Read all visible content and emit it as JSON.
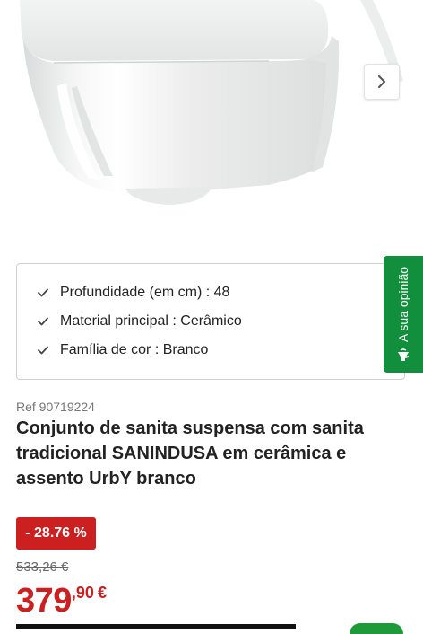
{
  "gallery": {
    "next_icon": "chevron-right-icon"
  },
  "features": [
    {
      "icon": "check-icon",
      "text": "Profundidade (em cm) : 48"
    },
    {
      "icon": "check-icon",
      "text": "Material principal : Cerâmico"
    },
    {
      "icon": "check-icon",
      "text": "Família de cor : Branco"
    }
  ],
  "feedback": {
    "label": "A sua opinião",
    "icon": "megaphone-icon",
    "color": "#128f3c"
  },
  "product": {
    "ref": "Ref 90719224",
    "title": "Conjunto de sanita suspensa com sanita tradicional SANINDUSA em cerâmica e assento UrbY branco",
    "discount": "- 28.76 %",
    "old_price": "533,26 €",
    "price_int": "379",
    "price_dec": ",90",
    "currency": "€"
  },
  "colors": {
    "accent_red": "#cc1f1f",
    "accent_green": "#128f3c"
  }
}
